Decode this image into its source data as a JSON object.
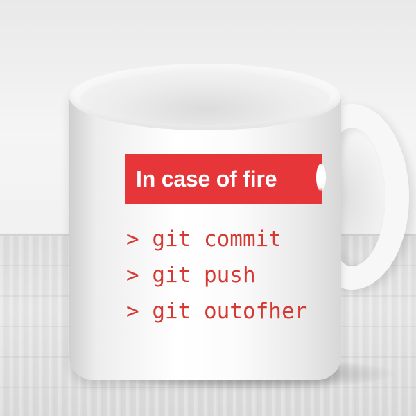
{
  "scene": {
    "subject": "mug",
    "colors": {
      "banner": "#e7363a",
      "banner_text": "#ffffff",
      "command_text": "#d43a33",
      "mug": "#ffffff",
      "table": "#dcdcdc"
    }
  },
  "mug_print": {
    "banner_text": "In case of fire",
    "banner_icon": "fire-icon",
    "commands": [
      "> git commit",
      "> git push",
      "> git outofher"
    ]
  }
}
